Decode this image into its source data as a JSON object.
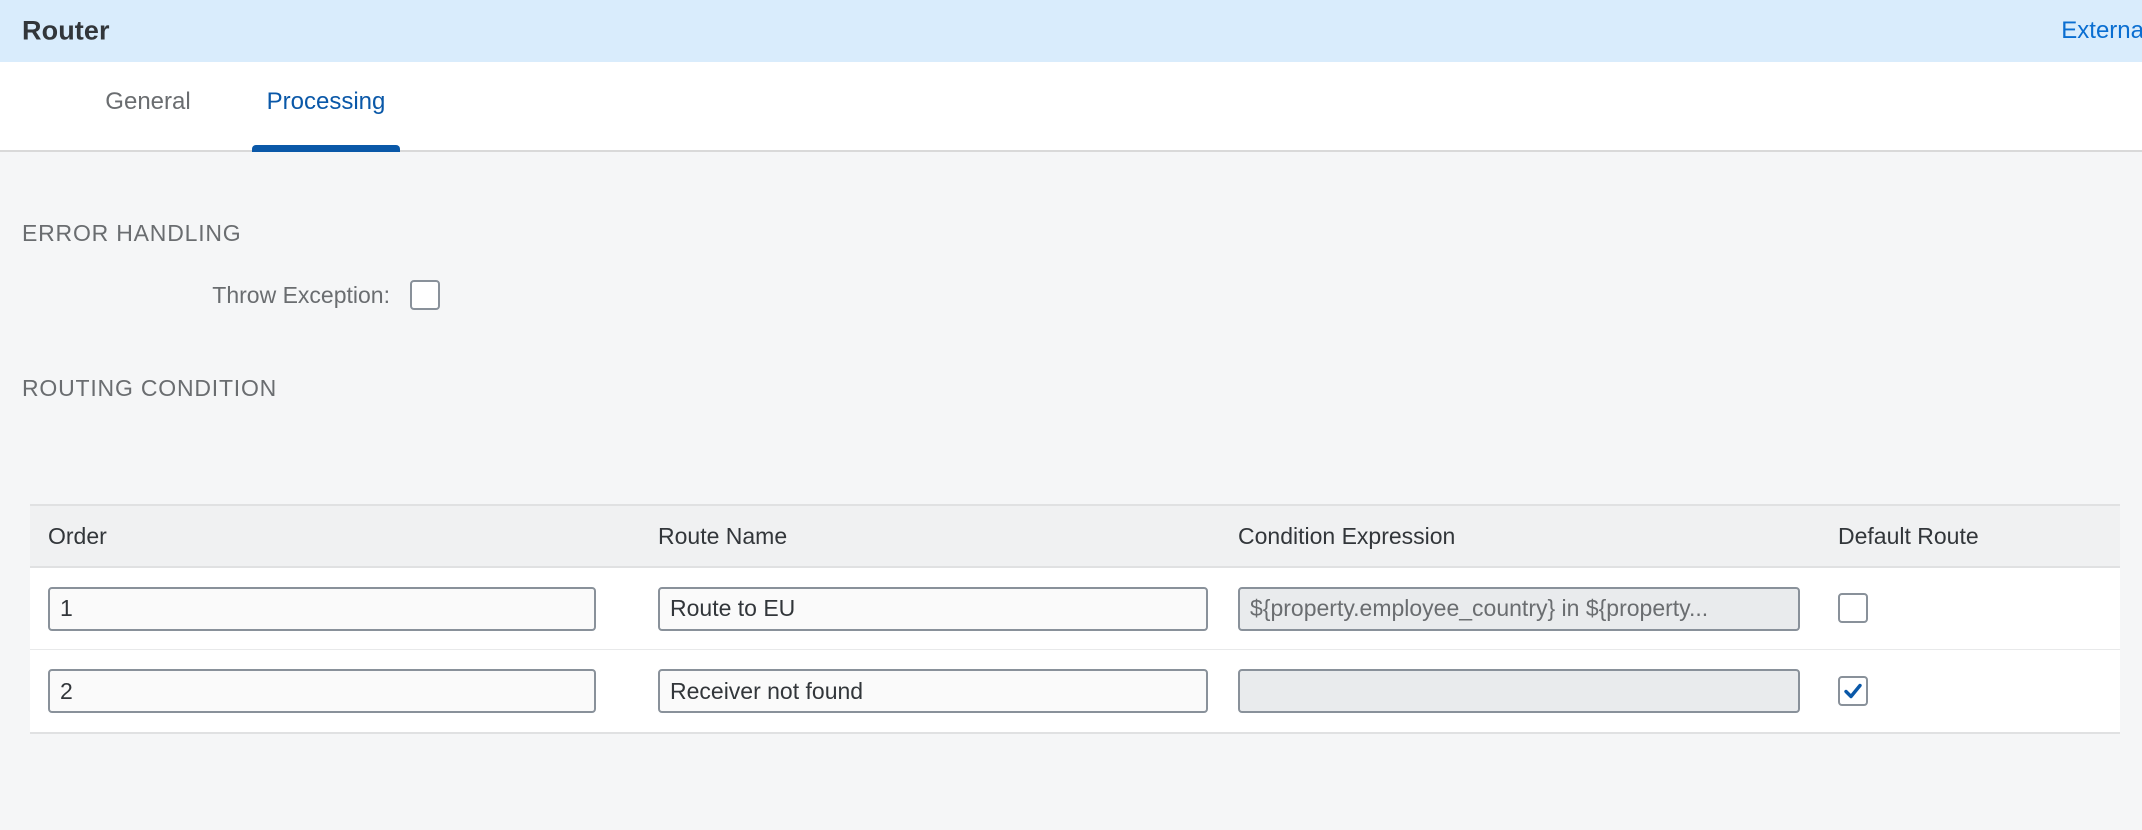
{
  "header": {
    "title": "Router",
    "action_label": "Externalize"
  },
  "tabs": [
    {
      "label": "General",
      "selected": false
    },
    {
      "label": "Processing",
      "selected": true
    }
  ],
  "sections": {
    "error_handling": {
      "title": "ERROR HANDLING",
      "throw_exception_label": "Throw Exception:",
      "throw_exception_checked": false
    },
    "routing_condition": {
      "title": "ROUTING CONDITION"
    }
  },
  "table": {
    "columns": {
      "order": "Order",
      "route_name": "Route Name",
      "condition_expression": "Condition Expression",
      "default_route": "Default Route"
    },
    "rows": [
      {
        "order": "1",
        "route_name": "Route to EU",
        "condition_expression": "${property.employee_country} in ${property...",
        "condition_disabled": false,
        "default_route": false
      },
      {
        "order": "2",
        "route_name": "Receiver not found",
        "condition_expression": "",
        "condition_disabled": true,
        "default_route": true
      }
    ]
  },
  "colors": {
    "header_band": "#d9ecfc",
    "accent": "#0a6ed1",
    "tab_selected": "#0a58a8",
    "content_bg": "#f5f6f7",
    "text_primary": "#32363a",
    "text_secondary": "#6a6d70"
  }
}
